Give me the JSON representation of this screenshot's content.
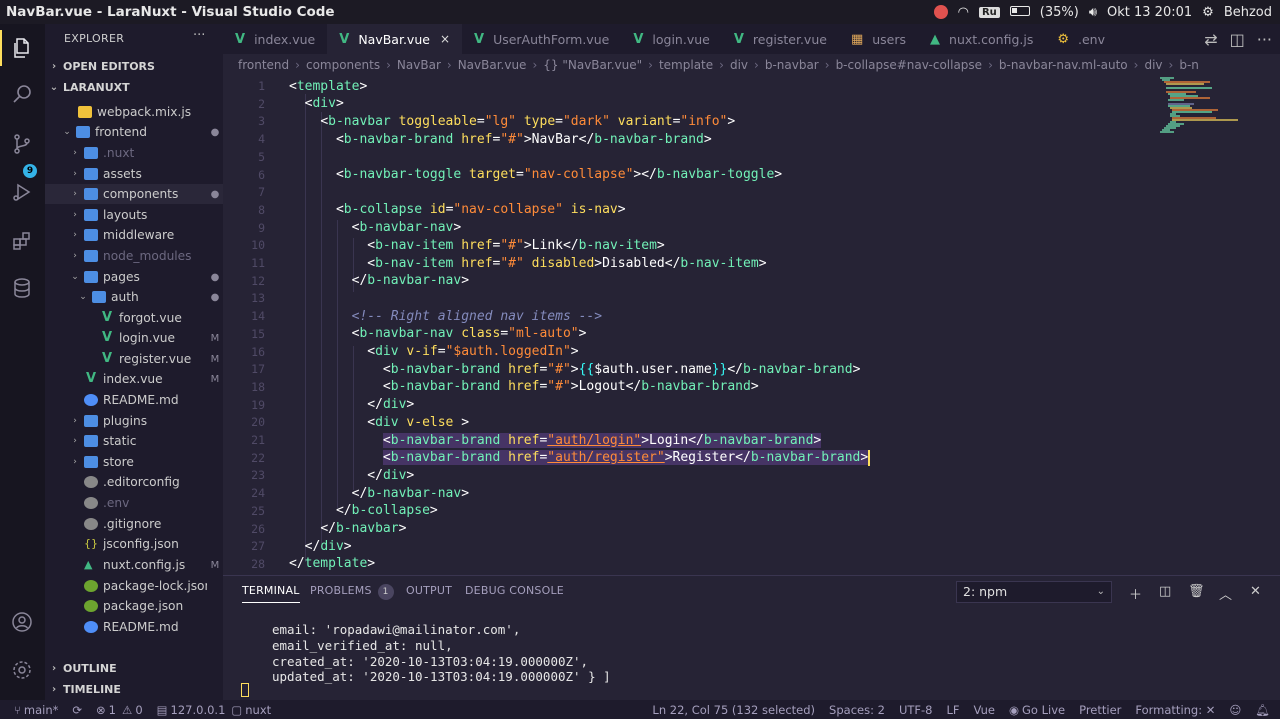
{
  "topbar": {
    "window_title": "NavBar.vue - LaraNuxt - Visual Studio Code",
    "lang": "Ru",
    "battery": "(35%)",
    "battery_level": 0.35,
    "datetime": "Okt 13 20:01",
    "user": "Behzod"
  },
  "activity": {
    "scm_badge": "9"
  },
  "sidebar": {
    "title": "EXPLORER",
    "more": "···",
    "open_editors": "OPEN EDITORS",
    "project": "LARANUXT",
    "outline": "OUTLINE",
    "timeline": "TIMELINE",
    "items": [
      {
        "label": "webpack.mix.js",
        "status": ""
      },
      {
        "label": "frontend",
        "status": "●"
      },
      {
        "label": ".nuxt",
        "status": ""
      },
      {
        "label": "assets",
        "status": ""
      },
      {
        "label": "components",
        "status": "●"
      },
      {
        "label": "layouts",
        "status": ""
      },
      {
        "label": "middleware",
        "status": ""
      },
      {
        "label": "node_modules",
        "status": ""
      },
      {
        "label": "pages",
        "status": "●"
      },
      {
        "label": "auth",
        "status": "●"
      },
      {
        "label": "forgot.vue",
        "status": ""
      },
      {
        "label": "login.vue",
        "status": "M"
      },
      {
        "label": "register.vue",
        "status": "M"
      },
      {
        "label": "index.vue",
        "status": "M"
      },
      {
        "label": "README.md",
        "status": ""
      },
      {
        "label": "plugins",
        "status": ""
      },
      {
        "label": "static",
        "status": ""
      },
      {
        "label": "store",
        "status": ""
      },
      {
        "label": ".editorconfig",
        "status": ""
      },
      {
        "label": ".env",
        "status": ""
      },
      {
        "label": ".gitignore",
        "status": ""
      },
      {
        "label": "jsconfig.json",
        "status": ""
      },
      {
        "label": "nuxt.config.js",
        "status": "M"
      },
      {
        "label": "package-lock.json",
        "status": ""
      },
      {
        "label": "package.json",
        "status": ""
      },
      {
        "label": "README.md",
        "status": ""
      }
    ]
  },
  "tabs": [
    {
      "label": "index.vue"
    },
    {
      "label": "NavBar.vue",
      "close": "×"
    },
    {
      "label": "UserAuthForm.vue"
    },
    {
      "label": "login.vue"
    },
    {
      "label": "register.vue"
    },
    {
      "label": "users"
    },
    {
      "label": "nuxt.config.js"
    },
    {
      "label": ".env"
    }
  ],
  "breadcrumb": [
    "frontend",
    "components",
    "NavBar",
    "NavBar.vue",
    "{} \"NavBar.vue\"",
    "template",
    "div",
    "b-navbar",
    "b-collapse#nav-collapse",
    "b-navbar-nav.ml-auto",
    "div",
    "b-n"
  ],
  "editor": {
    "lines": [
      "1",
      "2",
      "3",
      "4",
      "5",
      "6",
      "7",
      "8",
      "9",
      "10",
      "11",
      "12",
      "13",
      "14",
      "15",
      "16",
      "17",
      "18",
      "19",
      "20",
      "21",
      "22",
      "23",
      "24",
      "25",
      "26",
      "27",
      "28"
    ]
  },
  "panel": {
    "tabs": [
      "TERMINAL",
      "PROBLEMS",
      "OUTPUT",
      "DEBUG CONSOLE"
    ],
    "problems_count": "1",
    "terminal_select": "2: npm",
    "terminal_lines": [
      "email: 'ropadawi@mailinator.com',",
      "email_verified_at: null,",
      "created_at: '2020-10-13T03:04:19.000000Z',",
      "updated_at: '2020-10-13T03:04:19.000000Z' } ]"
    ]
  },
  "statusbar": {
    "branch": "main*",
    "errors": "1",
    "warnings": "0",
    "host": "127.0.0.1",
    "nuxt": "nuxt",
    "position": "Ln 22, Col 75 (132 selected)",
    "spaces": "Spaces: 2",
    "encoding": "UTF-8",
    "eol": "LF",
    "language": "Vue",
    "golive": "Go Live",
    "prettier": "Prettier",
    "formatting": "Formatting: ✕"
  },
  "colors": {
    "accent": "#fede5d",
    "tag": "#72f1b8",
    "string": "#ff8b39",
    "vue": "#41b883"
  }
}
